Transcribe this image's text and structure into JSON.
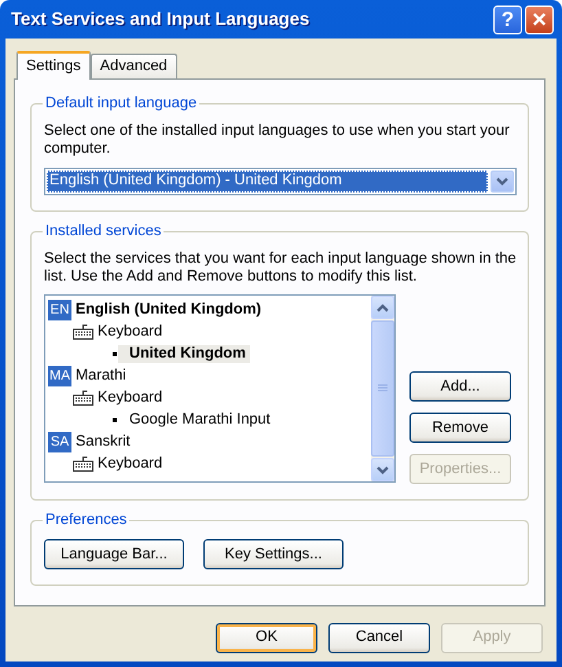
{
  "window": {
    "title": "Text Services and Input Languages",
    "help_button": "?",
    "close_button": "×"
  },
  "tabs": [
    {
      "label": "Settings",
      "selected": true
    },
    {
      "label": "Advanced",
      "selected": false
    }
  ],
  "default_language": {
    "title": "Default input language",
    "description": "Select one of the installed input languages to use when you start your computer.",
    "value": "English (United Kingdom) - United Kingdom"
  },
  "installed_services": {
    "title": "Installed services",
    "description": "Select the services that you want for each input language shown in the list. Use the Add and Remove buttons to modify this list.",
    "languages": [
      {
        "code": "EN",
        "name": "English (United Kingdom)",
        "default": true,
        "children": [
          {
            "name": "Keyboard",
            "children": [
              {
                "name": "United Kingdom",
                "default": true,
                "selected": true
              }
            ]
          }
        ]
      },
      {
        "code": "MA",
        "name": "Marathi",
        "default": false,
        "children": [
          {
            "name": "Keyboard",
            "children": [
              {
                "name": "Google Marathi Input",
                "default": false,
                "selected": false
              }
            ]
          }
        ]
      },
      {
        "code": "SA",
        "name": "Sanskrit",
        "default": false,
        "children": [
          {
            "name": "Keyboard"
          }
        ]
      }
    ],
    "buttons": [
      {
        "label": "Add...",
        "disabled": false
      },
      {
        "label": "Remove",
        "disabled": false
      },
      {
        "label": "Properties...",
        "disabled": true
      }
    ]
  },
  "preferences": {
    "title": "Preferences",
    "buttons": [
      {
        "label": "Language Bar..."
      },
      {
        "label": "Key Settings..."
      }
    ]
  },
  "footer_buttons": [
    {
      "label": "OK",
      "default": true,
      "disabled": false
    },
    {
      "label": "Cancel",
      "default": false,
      "disabled": false
    },
    {
      "label": "Apply",
      "default": false,
      "disabled": true
    }
  ]
}
